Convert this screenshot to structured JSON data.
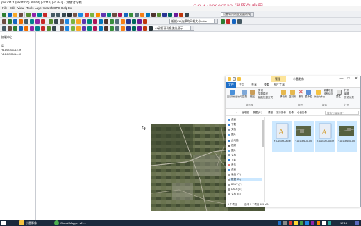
{
  "gm": {
    "title": "per v21.1 (b0d7820) [64-bit] (v2715) [v1.044] - 测色讨论稿",
    "watermark": "QQ 1439996522 消原创教程",
    "menu": [
      "File",
      "Edit",
      "View",
      "Tools",
      "Layer",
      "Search",
      "GPS",
      "Help",
      "Ex"
    ],
    "combos": {
      "c1": "设置将用的此拍图的将...",
      "c2": "根据Ctrl选择的网格大小color",
      "c3": "Alt键打开彩色激光显示"
    },
    "panel": [
      "控制中心",
      "层",
      "Y1D1G06JLc.tif",
      "Y1D1G06JLc.tif"
    ]
  },
  "explorer": {
    "title_ctx": "管理",
    "title": "小番影像",
    "controls": [
      "—",
      "□",
      "✕"
    ],
    "tabs": [
      "文件",
      "主页",
      "共享",
      "查看",
      "图片工具"
    ],
    "ribbon": {
      "pin": "固定到快速访问",
      "copy": "复制",
      "paste": "粘贴",
      "cut": "剪切",
      "copypath": "复制路径",
      "shortcut": "粘贴快捷方式",
      "moveto": "移动到",
      "copyto": "复制到",
      "delete": "删除",
      "rename": "重命名",
      "newfolder": "新建文件夹",
      "newitem": "新建项目",
      "easyaccess": "轻松访问",
      "properties": "属性",
      "open": "打开",
      "edit": "编辑",
      "history": "历史记录",
      "selectall": "全部选择",
      "selectnone": "全部取消",
      "invert": "反向选择",
      "g_clipboard": "剪贴板",
      "g_organize": "组织",
      "g_new": "新建",
      "g_open": "打开",
      "g_select": "选择"
    },
    "address": [
      "此电脑",
      "数据 (E:)",
      "课程",
      "演示影像",
      "影像",
      "小番影像"
    ],
    "search_placeholder": "搜索\"小番影像\"",
    "nav": [
      "桌面",
      "下载",
      "文档",
      "图片",
      "此电脑",
      "视频",
      "图片",
      "文档",
      "下载",
      "音乐",
      "桌面",
      "系统 (C:)",
      "数据 (D:)",
      "BDUT (F:)",
      "DATA (G:)",
      "文档 (E:)"
    ],
    "files": [
      "Y1D1G06OJLc.tf",
      "Y1D1G06OJLc.tif",
      "Y1D1G06OJLc.tif",
      "Y1D1G06OJLc.tif",
      "Y1D1G06OJLc.tif",
      "Y1D1G06OJLc.tif"
    ],
    "status": {
      "count": "6 个项目",
      "selected": "选中 1 个项目 405 MB"
    }
  },
  "taskbar": {
    "items": [
      "小番影像",
      "Global Mapper v21..."
    ],
    "time": "17:13"
  },
  "colors": {
    "taskbar": "#1b2a3d",
    "accent": "#1f6fc7",
    "selection": "#cce8ff",
    "watermark": "#d44a6a"
  }
}
